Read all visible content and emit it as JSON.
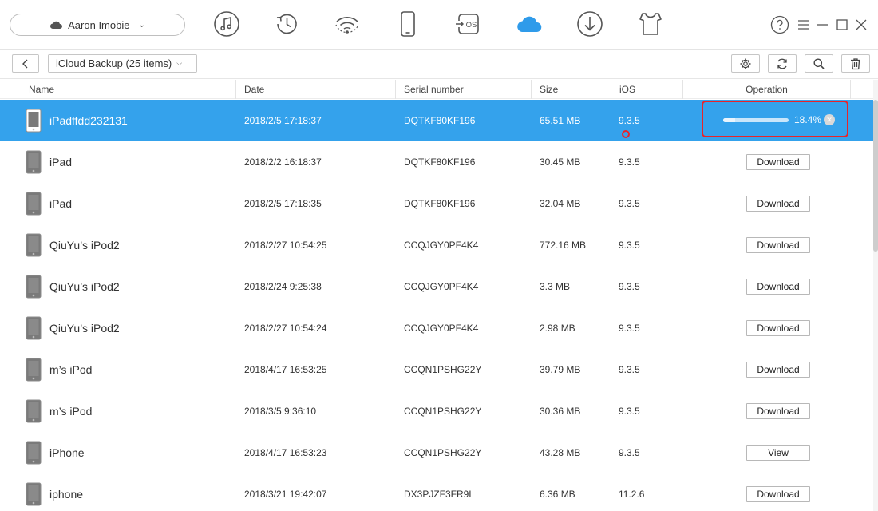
{
  "account": {
    "name": "Aaron Imobie",
    "icon": "cloud-icon"
  },
  "nav": {
    "items": [
      {
        "name": "music-nav-icon"
      },
      {
        "name": "history-nav-icon"
      },
      {
        "name": "wifi-nav-icon"
      },
      {
        "name": "device-nav-icon"
      },
      {
        "name": "ios-mover-nav-icon",
        "label": "iOS"
      },
      {
        "name": "icloud-nav-icon",
        "active": true
      },
      {
        "name": "download-nav-icon"
      },
      {
        "name": "toolkit-nav-icon"
      }
    ],
    "accent": "#2f9bea"
  },
  "breadcrumb": {
    "label": "iCloud Backup (25 items)"
  },
  "table": {
    "columns": [
      "Name",
      "Date",
      "Serial number",
      "Size",
      "iOS",
      "Operation"
    ],
    "rows": [
      {
        "name": "iPadffdd232131",
        "date": "2018/2/5 17:18:37",
        "serial": "DQTKF80KF196",
        "size": "65.51 MB",
        "ios": "9.3.5",
        "op": "progress",
        "progress_text": "18.4%",
        "progress": 0.184,
        "selected": true
      },
      {
        "name": "iPad",
        "date": "2018/2/2 16:18:37",
        "serial": "DQTKF80KF196",
        "size": "30.45 MB",
        "ios": "9.3.5",
        "op": "Download"
      },
      {
        "name": "iPad",
        "date": "2018/2/5 17:18:35",
        "serial": "DQTKF80KF196",
        "size": "32.04 MB",
        "ios": "9.3.5",
        "op": "Download"
      },
      {
        "name": "QiuYu’s iPod2",
        "date": "2018/2/27 10:54:25",
        "serial": "CCQJGY0PF4K4",
        "size": "772.16 MB",
        "ios": "9.3.5",
        "op": "Download"
      },
      {
        "name": "QiuYu’s iPod2",
        "date": "2018/2/24 9:25:38",
        "serial": "CCQJGY0PF4K4",
        "size": "3.3 MB",
        "ios": "9.3.5",
        "op": "Download"
      },
      {
        "name": "QiuYu’s iPod2",
        "date": "2018/2/27 10:54:24",
        "serial": "CCQJGY0PF4K4",
        "size": "2.98 MB",
        "ios": "9.3.5",
        "op": "Download"
      },
      {
        "name": "m’s iPod",
        "date": "2018/4/17 16:53:25",
        "serial": "CCQN1PSHG22Y",
        "size": "39.79 MB",
        "ios": "9.3.5",
        "op": "Download"
      },
      {
        "name": "m’s iPod",
        "date": "2018/3/5 9:36:10",
        "serial": "CCQN1PSHG22Y",
        "size": "30.36 MB",
        "ios": "9.3.5",
        "op": "Download"
      },
      {
        "name": "iPhone",
        "date": "2018/4/17 16:53:23",
        "serial": "CCQN1PSHG22Y",
        "size": "43.28 MB",
        "ios": "9.3.5",
        "op": "View"
      },
      {
        "name": "iphone",
        "date": "2018/3/21 19:42:07",
        "serial": "DX3PJZF3FR9L",
        "size": "6.36 MB",
        "ios": "11.2.6",
        "op": "Download"
      }
    ]
  },
  "colors": {
    "selected_row": "#34a2ec",
    "highlight": "#e8242a"
  }
}
